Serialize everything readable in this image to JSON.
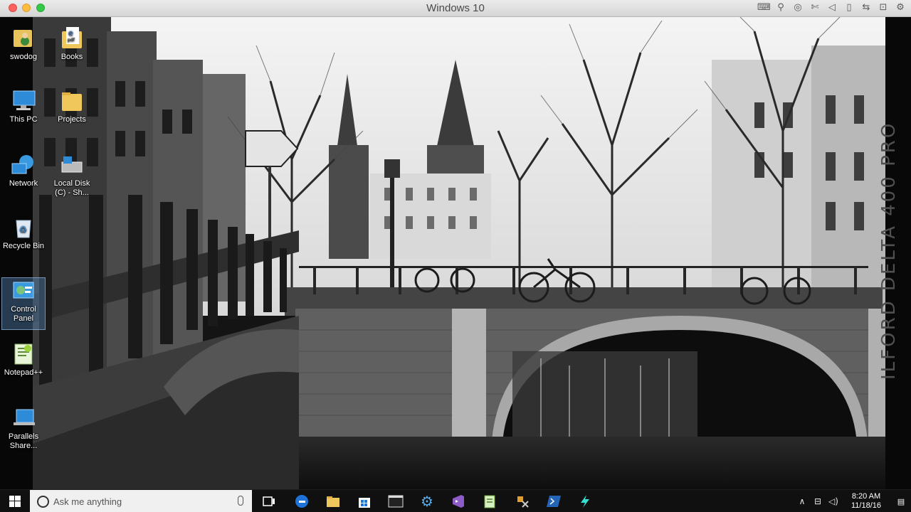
{
  "window": {
    "title": "Windows 10",
    "toolbar_icons": [
      "keyboard-icon",
      "usb-icon",
      "cd-icon",
      "camera-off-icon",
      "speaker-icon",
      "sd-card-icon",
      "shared-folder-icon",
      "lock-icon",
      "gear-icon"
    ]
  },
  "desktop": {
    "icons": [
      {
        "label": "swodog",
        "icon": "user-folder-icon"
      },
      {
        "label": "Books",
        "icon": "folder-pdf-icon"
      },
      {
        "label": "This PC",
        "icon": "computer-icon"
      },
      {
        "label": "Projects",
        "icon": "folder-icon"
      },
      {
        "label": "Network",
        "icon": "network-icon"
      },
      {
        "label": "Local Disk (C) - Sh...",
        "icon": "local-disk-icon"
      },
      {
        "label": "Recycle Bin",
        "icon": "recycle-bin-icon"
      },
      {
        "label": "Control Panel",
        "icon": "control-panel-icon"
      },
      {
        "label": "Notepad++",
        "icon": "notepad-plus-icon"
      },
      {
        "label": "Parallels Share...",
        "icon": "parallels-share-icon"
      }
    ],
    "wallpaper_text": "ILFORD DELTA 400 PRO"
  },
  "taskbar": {
    "search_placeholder": "Ask me anything",
    "apps": [
      "task-view-icon",
      "edge-icon",
      "file-explorer-icon",
      "store-icon",
      "terminal-icon",
      "settings-icon",
      "visual-studio-icon",
      "notepad-icon",
      "tools-icon",
      "powershell-icon",
      "lightning-icon"
    ],
    "time": "8:20 AM",
    "date": "11/18/16"
  }
}
